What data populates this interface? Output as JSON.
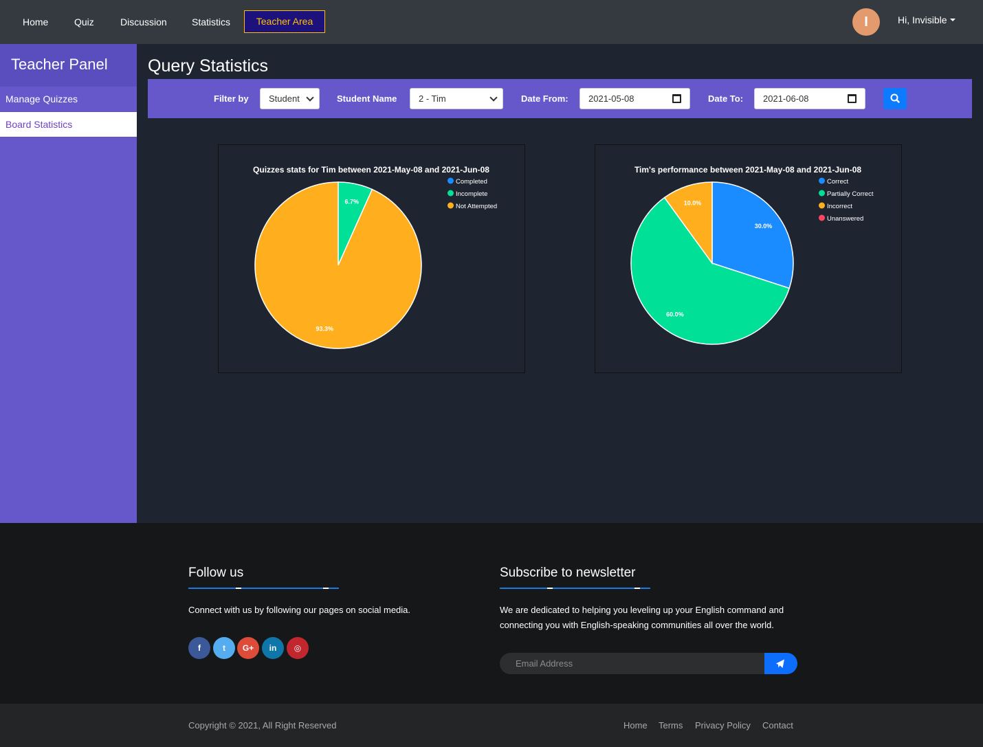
{
  "nav": {
    "items": [
      "Home",
      "Quiz",
      "Discussion",
      "Statistics",
      "Teacher Area"
    ],
    "avatar_initial": "I",
    "user_label": "Hi, Invisible"
  },
  "sidebar": {
    "title": "Teacher Panel",
    "items": [
      "Manage Quizzes",
      "Board Statistics"
    ]
  },
  "main": {
    "title": "Query Statistics",
    "filter": {
      "filter_by_label": "Filter by",
      "filter_by_value": "Student",
      "student_label": "Student Name",
      "student_value": "2 - Tim",
      "date_from_label": "Date From:",
      "date_from_value": "2021-05-08",
      "date_to_label": "Date To:",
      "date_to_value": "2021-06-08"
    }
  },
  "chart_data": [
    {
      "type": "pie",
      "title": "Quizzes stats for Tim between 2021-May-08 and 2021-Jun-08",
      "categories": [
        "Completed",
        "Incomplete",
        "Not Attempted"
      ],
      "values": [
        0,
        6.7,
        93.3
      ],
      "labels": [
        "",
        "6.7%",
        "93.3%"
      ],
      "colors": [
        "#1a8cff",
        "#00e096",
        "#ffaf1d"
      ],
      "legend": "top-right"
    },
    {
      "type": "pie",
      "title": "Tim's performance between 2021-May-08 and 2021-Jun-08",
      "categories": [
        "Correct",
        "Partially Correct",
        "Incorrect",
        "Unanswered"
      ],
      "values": [
        30,
        60,
        10,
        0
      ],
      "labels": [
        "30.0%",
        "60.0%",
        "10.0%",
        ""
      ],
      "colors": [
        "#1a8cff",
        "#00e096",
        "#ffaf1d",
        "#ff4560"
      ],
      "legend": "top-right"
    }
  ],
  "footer": {
    "follow_title": "Follow us",
    "follow_text": "Connect with us by following our pages on social media.",
    "social": [
      {
        "icon": "facebook-icon",
        "glyph": "f",
        "color": "#3b5998"
      },
      {
        "icon": "twitter-icon",
        "glyph": "t",
        "color": "#55acee"
      },
      {
        "icon": "google-plus-icon",
        "glyph": "G+",
        "color": "#dd4b39"
      },
      {
        "icon": "linkedin-icon",
        "glyph": "in",
        "color": "#0e76a8"
      },
      {
        "icon": "instagram-icon",
        "glyph": "◎",
        "color": "#c1272d"
      }
    ],
    "newsletter_title": "Subscribe to newsletter",
    "newsletter_text_1": "We are dedicated to helping you leveling up your English command and",
    "newsletter_text_2": "connecting you with English-speaking communities all over the world.",
    "email_placeholder": "Email Address",
    "copyright": "Copyright © 2021, All Right Reserved",
    "links": [
      "Home",
      "Terms",
      "Privacy Policy",
      "Contact"
    ]
  }
}
